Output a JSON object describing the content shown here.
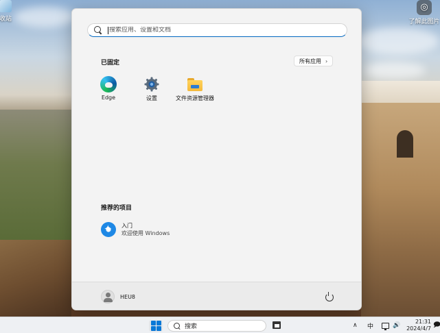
{
  "desktop": {
    "icons": [
      {
        "label": "收站"
      },
      {
        "label": "了解此图片"
      }
    ]
  },
  "start_menu": {
    "search_placeholder": "搜索应用、设置和文档",
    "pinned": {
      "title": "已固定",
      "all_apps_label": "所有应用",
      "apps": [
        {
          "label": "Edge",
          "icon": "edge-icon"
        },
        {
          "label": "设置",
          "icon": "gear-icon"
        },
        {
          "label": "文件资源管理器",
          "icon": "folder-icon"
        }
      ]
    },
    "recommended": {
      "title": "推荐的项目",
      "items": [
        {
          "title": "入门",
          "subtitle": "欢迎使用 Windows",
          "icon": "get-started-icon"
        }
      ]
    },
    "user": {
      "name": "HEU8"
    }
  },
  "taskbar": {
    "search_label": "搜索",
    "tray": {
      "chevron": "∧",
      "ime": "中",
      "volume": "🔊",
      "time": "21:31",
      "date": "2024/4/7",
      "notification": "🗩"
    }
  },
  "colors": {
    "accent": "#0067c0",
    "start_bg": "#f3f3f3",
    "taskbar_bg": "#eef0f3"
  }
}
